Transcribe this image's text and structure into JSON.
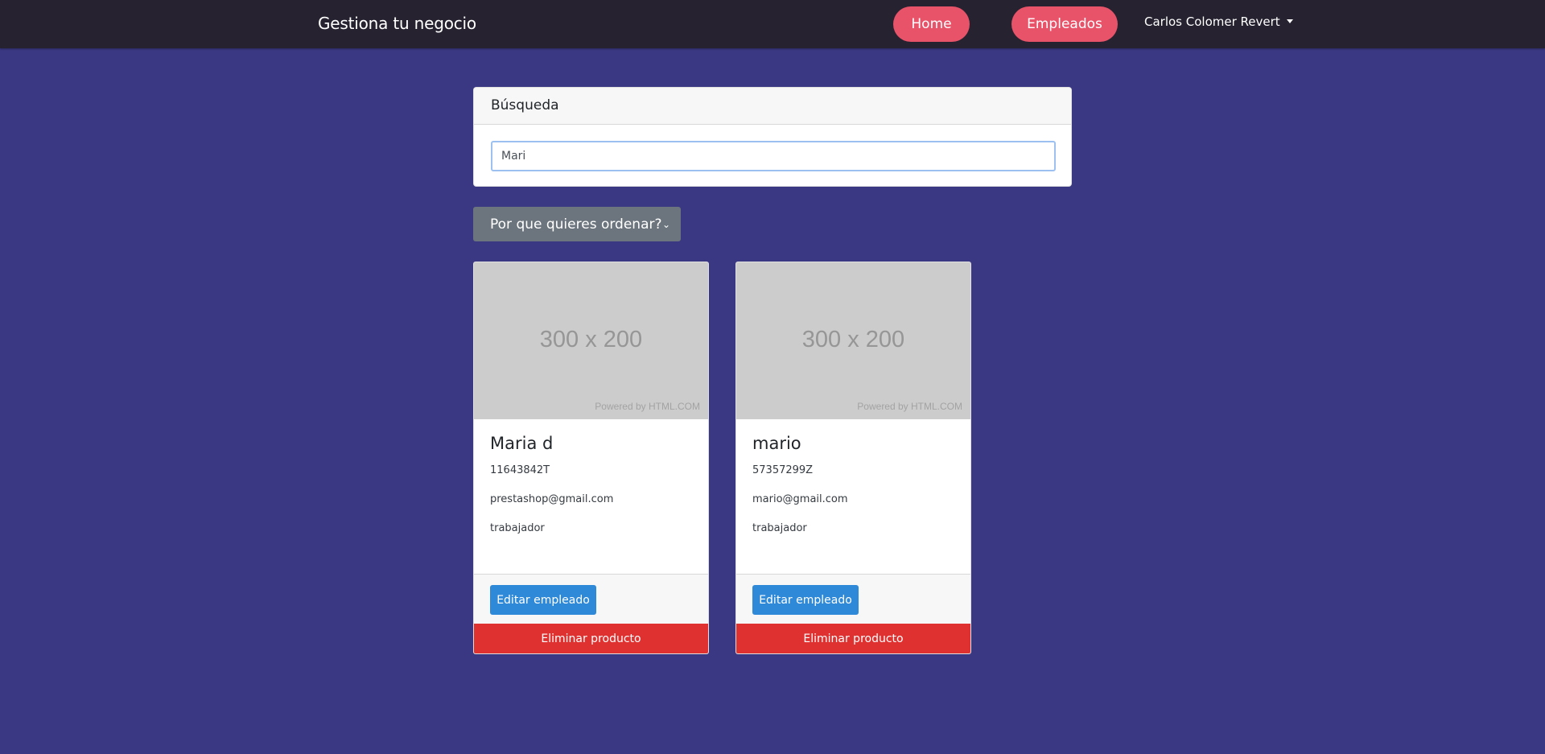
{
  "navbar": {
    "brand": "Gestiona tu negocio",
    "home_label": "Home",
    "empleados_label": "Empleados",
    "user_name": "Carlos Colomer Revert"
  },
  "search": {
    "title": "Búsqueda",
    "value": "Mari"
  },
  "sort": {
    "selected": "Por que quieres ordenar?"
  },
  "placeholder": {
    "size_text": "300 x 200",
    "powered_text": "Powered by HTML.COM"
  },
  "cards": [
    {
      "name": "Maria d",
      "dni": "11643842T",
      "email": "prestashop@gmail.com",
      "role": "trabajador",
      "edit_label": "Editar empleado",
      "delete_label": "Eliminar producto"
    },
    {
      "name": "mario",
      "dni": "57357299Z",
      "email": "mario@gmail.com",
      "role": "trabajador",
      "edit_label": "Editar empleado",
      "delete_label": "Eliminar producto"
    }
  ],
  "colors": {
    "background": "#3a3882",
    "navbar": "#26222f",
    "nav_pill": "#e85369",
    "edit_button": "#2f89d9",
    "delete_button": "#e03131",
    "sort_select": "#6c757d"
  }
}
